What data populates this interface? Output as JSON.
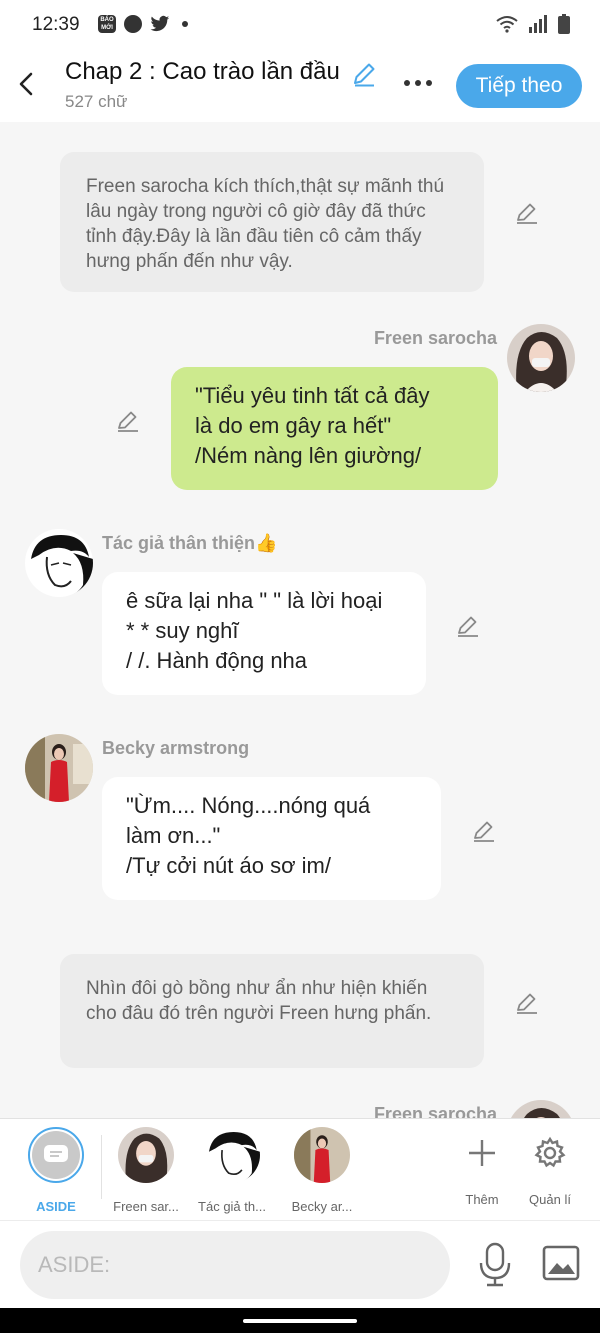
{
  "status": {
    "time": "12:39",
    "news_app_label": "BÁO MỚI"
  },
  "header": {
    "title": "Chap 2 : Cao trào lần đầu",
    "word_count": "527 chữ",
    "next_label": "Tiếp theo"
  },
  "messages": {
    "narration1": "Freen sarocha kích thích,thật sự mãnh thú lâu ngày trong người cô giờ đây đã thức tỉnh đậy.Đây là lần đầu tiên cô cảm thấy hưng phấn đến như vậy.",
    "msg2_sender": "Freen sarocha",
    "msg2_text": "\"Tiểu yêu tinh tất cả đây\nlà do em gây ra hết\"\n/Ném nàng lên giường/",
    "msg3_sender": "Tác giả thân thiện👍",
    "msg3_text": "ê sữa lại nha \" \" là lời hoại\n* * suy nghĩ\n/ /. Hành động nha",
    "msg4_sender": "Becky armstrong",
    "msg4_text": "\"Ừm.... Nóng....nóng quá\nlàm ơn...\"\n/Tự cởi nút áo sơ im/",
    "narration2": "Nhìn đôi gò bồng như ẩn như hiện khiến cho đâu đó trên người Freen hưng phấn.",
    "msg6_sender": "Freen sarocha"
  },
  "character_bar": {
    "aside_label": "ASIDE",
    "characters": [
      "Freen sar...",
      "Tác giả th...",
      "Becky ar..."
    ],
    "add_label": "Thêm",
    "manage_label": "Quản lí"
  },
  "input": {
    "placeholder": "ASIDE:"
  },
  "colors": {
    "accent": "#4aa8ea",
    "green_bubble": "#cdea8e",
    "narration_bg": "#ececec"
  },
  "icons": [
    "back-arrow-icon",
    "pencil-icon",
    "more-dots-icon",
    "plus-icon",
    "gear-icon",
    "microphone-icon",
    "image-icon",
    "wifi-icon",
    "signal-icon",
    "battery-icon",
    "twitter-icon"
  ]
}
